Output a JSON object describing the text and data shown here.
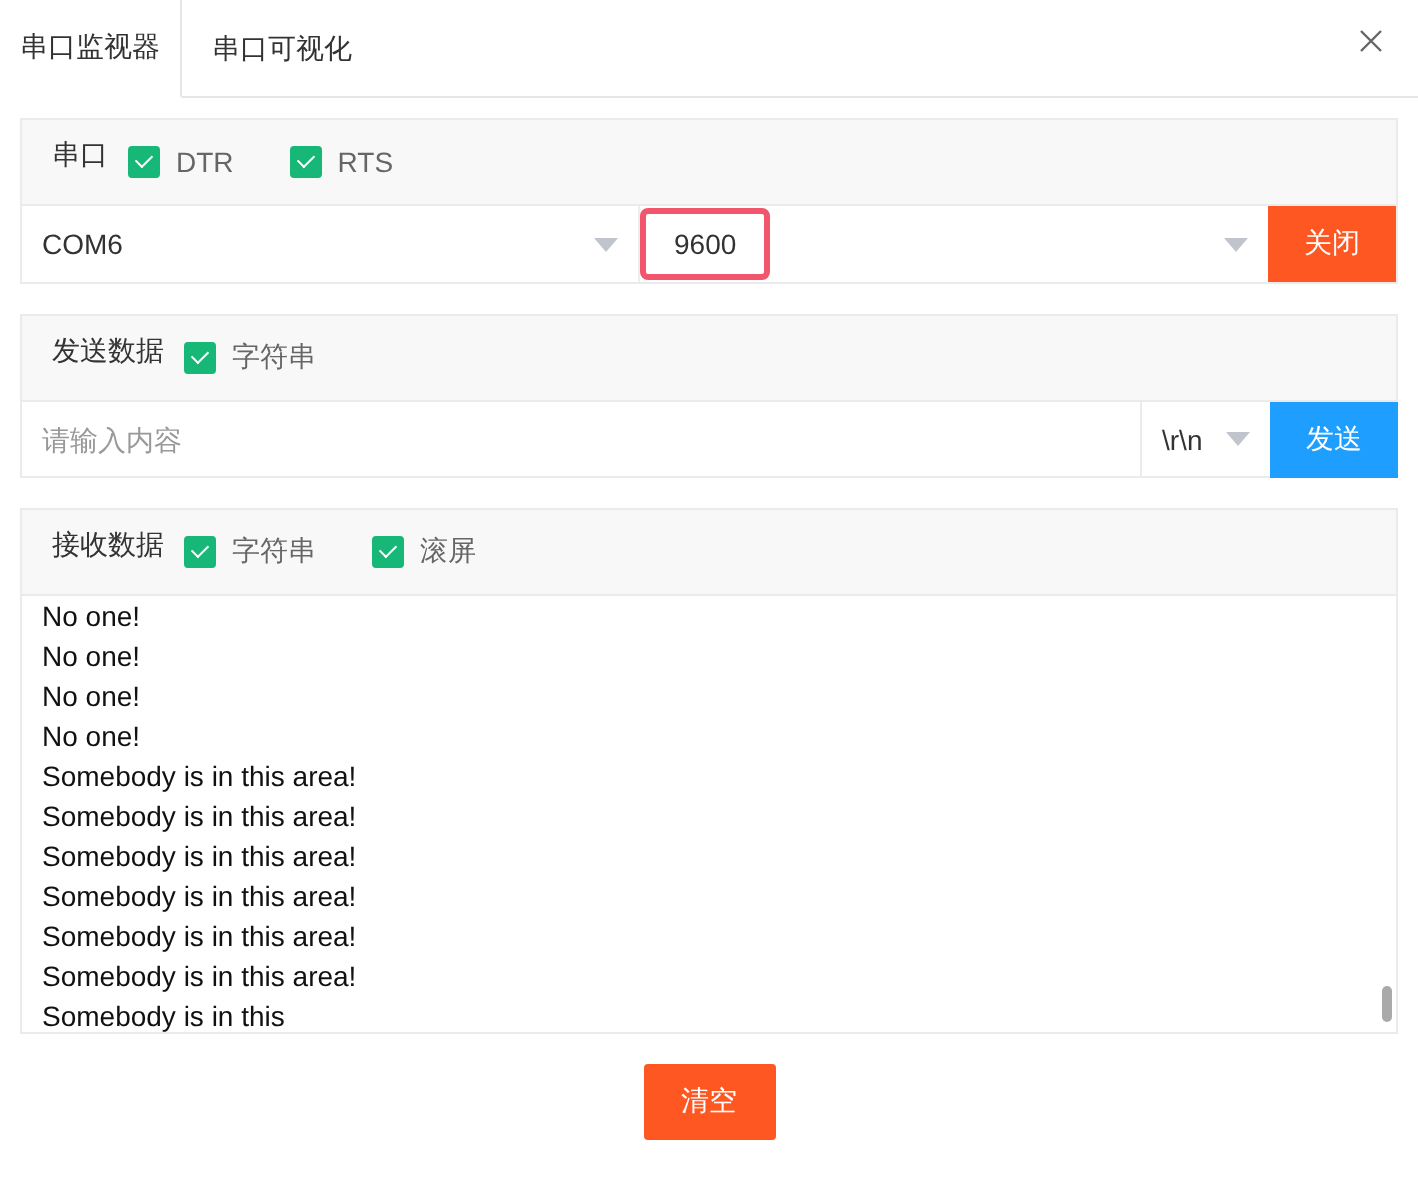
{
  "tabs": [
    {
      "label": "串口监视器",
      "selected": true
    },
    {
      "label": "串口可视化",
      "selected": false
    }
  ],
  "serial": {
    "label": "串口",
    "options": [
      {
        "label": "DTR",
        "checked": true
      },
      {
        "label": "RTS",
        "checked": true
      }
    ],
    "port": "COM6",
    "baud": "9600",
    "baud_highlighted": true,
    "button": "关闭"
  },
  "send": {
    "label": "发送数据",
    "options": [
      {
        "label": "字符串",
        "checked": true
      }
    ],
    "placeholder": "请输入内容",
    "line_ending": "\\r\\n",
    "button": "发送"
  },
  "receive": {
    "label": "接收数据",
    "options": [
      {
        "label": "字符串",
        "checked": true
      },
      {
        "label": "滚屏",
        "checked": true
      }
    ],
    "lines": [
      "No one!",
      "No one!",
      "No one!",
      "No one!",
      "Somebody is in this area!",
      "Somebody is in this area!",
      "Somebody is in this area!",
      "Somebody is in this area!",
      "Somebody is in this area!",
      "Somebody is in this area!",
      "Somebody is in this"
    ]
  },
  "clear_button": "清空"
}
